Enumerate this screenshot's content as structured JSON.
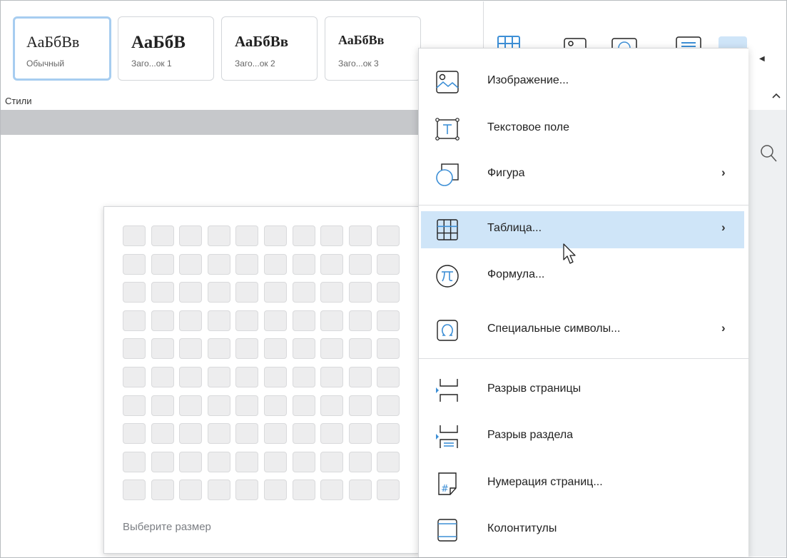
{
  "ribbon": {
    "styles": [
      {
        "sample": "АаБбВв",
        "caption": "Обычный",
        "selected": true
      },
      {
        "sample": "АаБбВ",
        "caption": "Заго...ок 1"
      },
      {
        "sample": "АаБбВв",
        "caption": "Заго...ок 2"
      },
      {
        "sample": "АаБбВв",
        "caption": "Заго...ок 3"
      }
    ],
    "group_label": "Стили",
    "toolbar_icons": [
      "table-icon",
      "image-icon",
      "shape-icon",
      "text-align-icon"
    ]
  },
  "insert_menu": {
    "items": [
      {
        "label": "Изображение...",
        "icon": "image-icon",
        "submenu": false
      },
      {
        "label": "Текстовое поле",
        "icon": "text-box-icon",
        "submenu": false
      },
      {
        "label": "Фигура",
        "icon": "shape-icon",
        "submenu": true
      },
      {
        "label": "Таблица...",
        "icon": "table-icon",
        "submenu": true,
        "highlighted": true
      },
      {
        "label": "Формула...",
        "icon": "formula-icon",
        "submenu": false
      },
      {
        "label": "Специальные символы...",
        "icon": "omega-icon",
        "submenu": true
      },
      {
        "label": "Разрыв страницы",
        "icon": "page-break-icon",
        "submenu": false
      },
      {
        "label": "Разрыв раздела",
        "icon": "section-break-icon",
        "submenu": false
      },
      {
        "label": "Нумерация страниц...",
        "icon": "page-numbering-icon",
        "submenu": false
      },
      {
        "label": "Колонтитулы",
        "icon": "header-footer-icon",
        "submenu": false
      }
    ],
    "submenu_arrow": "›"
  },
  "table_picker": {
    "columns": 10,
    "rows": 10,
    "hint": "Выберите размер"
  },
  "colors": {
    "accent": "#3d8fd6",
    "highlight": "#cfe5f8"
  }
}
